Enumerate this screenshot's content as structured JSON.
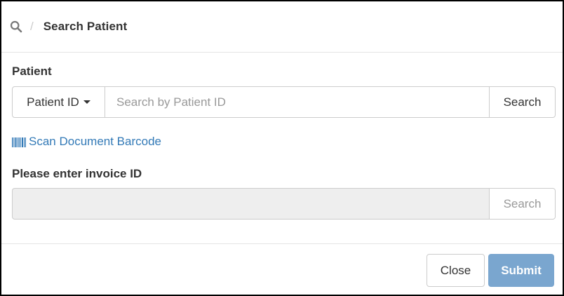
{
  "header": {
    "icon": "search-icon",
    "separator": "/",
    "title": "Search Patient"
  },
  "patient": {
    "label": "Patient",
    "dropdown_label": "Patient ID",
    "placeholder": "Search by Patient ID",
    "value": "",
    "search_label": "Search"
  },
  "barcode": {
    "icon": "barcode-icon",
    "label": "Scan Document Barcode"
  },
  "invoice": {
    "label": "Please enter invoice ID",
    "value": "",
    "search_label": "Search"
  },
  "footer": {
    "close_label": "Close",
    "submit_label": "Submit"
  },
  "colors": {
    "link": "#337ab7",
    "primary_disabled": "#7aa6cf",
    "input_disabled_bg": "#eeeeee",
    "border": "#cccccc"
  }
}
